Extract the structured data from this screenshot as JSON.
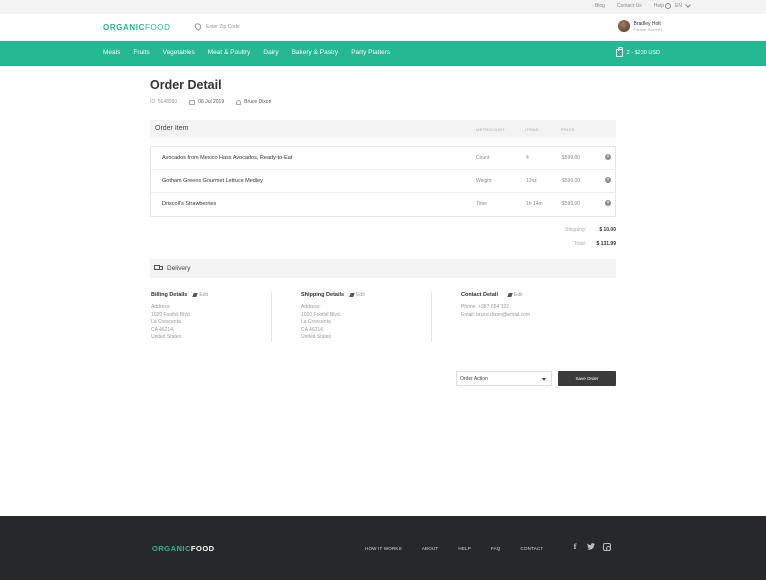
{
  "topbar": {
    "links": [
      "Blog",
      "Contact Us",
      "Help"
    ],
    "language": "EN"
  },
  "header": {
    "logo_part1": "ORGANIC",
    "logo_part2": "FOOD",
    "zip_placeholder": "Enter Zip Code",
    "user_name": "Bradley Holt",
    "user_role": "Partner Account"
  },
  "nav": {
    "items": [
      "Meals",
      "Fruits",
      "Vegetables",
      "Meat & Poultry",
      "Dairy",
      "Bakery & Pastry",
      "Party Platters"
    ],
    "cart_summary": "2 - $230 USD"
  },
  "order": {
    "title": "Order Detail",
    "id": "ID: 5648990",
    "date": "06 Jul 2019",
    "customer": "Bruce Dixon"
  },
  "order_items": {
    "header": "Order Item",
    "columns": [
      "METRIC/UNIT",
      "ITEMS",
      "PRICE"
    ],
    "rows": [
      {
        "name": "Avocados from Mexico Hass Avocados, Ready-to-Eat",
        "metric": "Count",
        "items": "4",
        "price": "$599.00"
      },
      {
        "name": "Gotham Greens Gourmet Lettuce Medley",
        "metric": "Weight",
        "items": "12oz",
        "price": "$599.00"
      },
      {
        "name": "Driscoll's Strawberries",
        "metric": "Time",
        "items": "1h 14m",
        "price": "$599.00"
      }
    ],
    "shipping_label": "Shipping:",
    "shipping_value": "$ 10.00",
    "total_label": "Total:",
    "total_value": "$ 131.99"
  },
  "delivery": {
    "header": "Delivery",
    "edit_label": "Edit",
    "billing": {
      "title": "Billing Details",
      "lines": [
        "Address:",
        "1020 Foothil Blvd",
        "La Crescenta",
        "CA 46214,",
        "United States"
      ]
    },
    "shipping": {
      "title": "Shipping Details",
      "lines": [
        "Address:",
        "1020 Foothil Blvd.",
        "La Crescenta",
        "CA 46214,",
        "United States"
      ]
    },
    "contact": {
      "title": "Contact Detail",
      "lines": [
        "Phone: +987 654 322",
        "Email: bruce.dixon@email.com"
      ]
    }
  },
  "actions": {
    "order_action": "Order Action",
    "save_label": "Save Order"
  },
  "footer": {
    "logo_part1": "ORGANIC",
    "logo_part2": "FOOD",
    "links": [
      "HOW IT WORKS",
      "ABOUT",
      "HELP",
      "FAQ",
      "CONTACT"
    ]
  },
  "colors": {
    "brand_green": "#24b893",
    "footer_bg": "#26282b",
    "button_dark": "#3a3a3a"
  }
}
